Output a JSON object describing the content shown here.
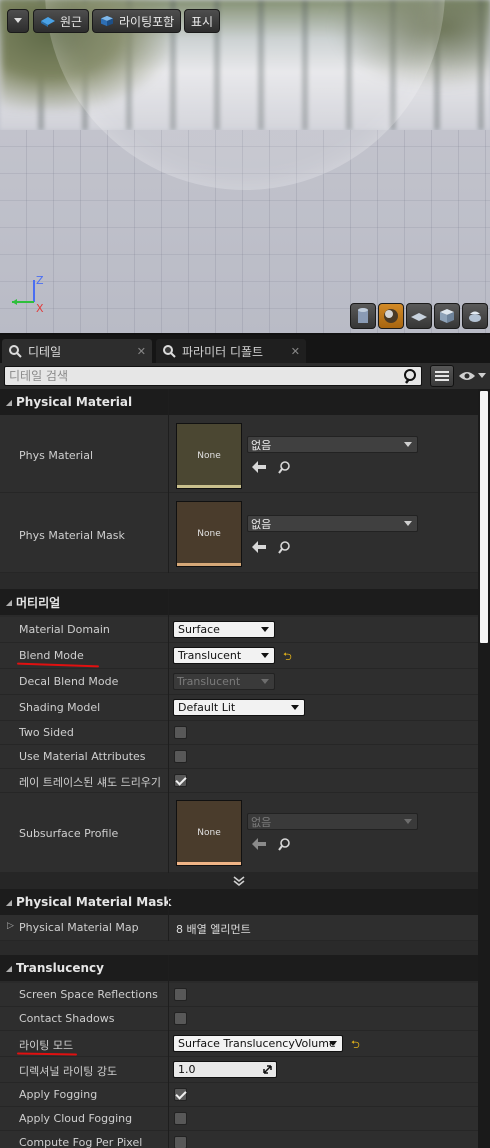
{
  "viewport": {
    "perspective_label": "원근",
    "lighting_label": "라이팅포함",
    "show_label": "표시",
    "axis_z": "Z",
    "axis_x": "X"
  },
  "tabs": [
    {
      "label": "디테일"
    },
    {
      "label": "파라미터 디폴트"
    }
  ],
  "search": {
    "placeholder": "디테일 검색"
  },
  "sections": {
    "physical_material": {
      "title": "Physical Material",
      "rows": {
        "phys_material": {
          "label": "Phys Material",
          "thumb": "None",
          "value": "없음",
          "color": "#4b4732",
          "bar": "#c9c08d"
        },
        "phys_material_mask": {
          "label": "Phys Material Mask",
          "thumb": "None",
          "value": "없음",
          "color": "#4a3c2c",
          "bar": "#d6a878"
        }
      }
    },
    "material": {
      "title": "머티리얼",
      "rows": {
        "material_domain": {
          "label": "Material Domain",
          "value": "Surface"
        },
        "blend_mode": {
          "label": "Blend Mode",
          "value": "Translucent"
        },
        "decal_blend_mode": {
          "label": "Decal Blend Mode",
          "value": "Translucent"
        },
        "shading_model": {
          "label": "Shading Model",
          "value": "Default Lit"
        },
        "two_sided": {
          "label": "Two Sided",
          "checked": false
        },
        "use_material_attributes": {
          "label": "Use Material Attributes",
          "checked": false
        },
        "ray_traced_shadows": {
          "label": "레이 트레이스된 섀도 드리우기",
          "checked": true
        },
        "subsurface_profile": {
          "label": "Subsurface Profile",
          "thumb": "None",
          "value": "없음",
          "color": "#4a3c2c",
          "bar": "#f0b486"
        }
      }
    },
    "physical_material_mask": {
      "title": "Physical Material Mask",
      "rows": {
        "map": {
          "label": "Physical Material Map",
          "value": "8 배열 엘리먼트"
        }
      }
    },
    "translucency": {
      "title": "Translucency",
      "rows": {
        "ssr": {
          "label": "Screen Space Reflections",
          "checked": false
        },
        "contact_shadows": {
          "label": "Contact Shadows",
          "checked": false
        },
        "lighting_mode": {
          "label": "라이팅 모드",
          "value": "Surface TranslucencyVolume"
        },
        "directional_lighting_intensity": {
          "label": "디렉셔널 라이팅 강도",
          "value": "1.0"
        },
        "apply_fogging": {
          "label": "Apply Fogging",
          "checked": true
        },
        "apply_cloud_fogging": {
          "label": "Apply Cloud Fogging",
          "checked": false
        },
        "compute_fog_per_pixel": {
          "label": "Compute Fog Per Pixel",
          "checked": false
        }
      }
    }
  },
  "reset_glyph": "⮌",
  "colors": {
    "accent": "#e0b01a",
    "active_button": "#c57a1b",
    "annotation_red": "#e01010"
  }
}
